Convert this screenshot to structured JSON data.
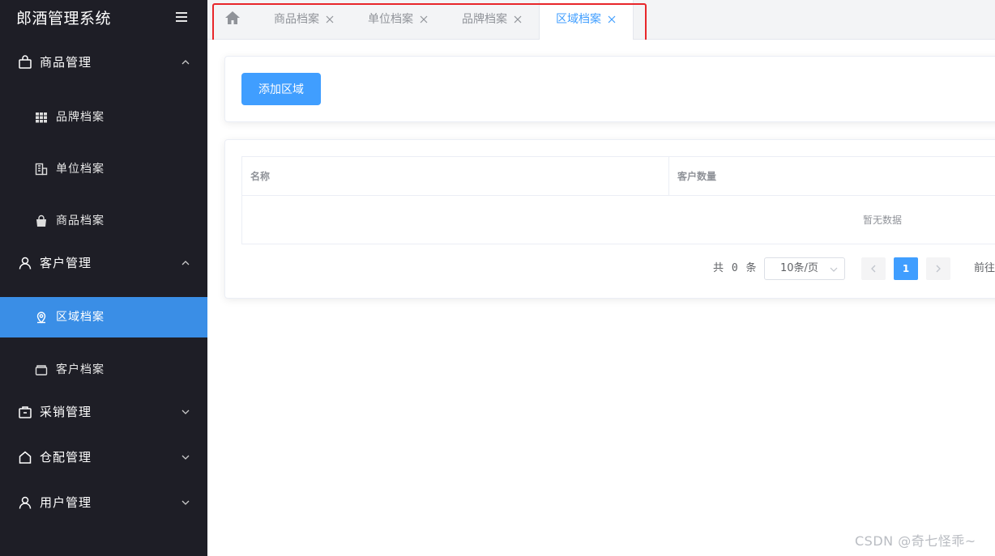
{
  "sidebar": {
    "brand": "郎酒管理系统",
    "groups": [
      {
        "label": "商品管理",
        "icon": "shopping-bag-icon"
      },
      {
        "label": "客户管理",
        "icon": "user-icon"
      },
      {
        "label": "采销管理",
        "icon": "briefcase-icon"
      },
      {
        "label": "仓配管理",
        "icon": "house-icon"
      },
      {
        "label": "用户管理",
        "icon": "user-icon"
      }
    ],
    "items": [
      {
        "label": "品牌档案",
        "icon": "grid-icon"
      },
      {
        "label": "单位档案",
        "icon": "office-building-icon"
      },
      {
        "label": "商品档案",
        "icon": "bag-icon"
      },
      {
        "label": "区域档案",
        "icon": "location-pin-icon"
      },
      {
        "label": "客户档案",
        "icon": "wallet-icon"
      }
    ],
    "active_color": "#3a8ee6",
    "background": "#1e1e26"
  },
  "tabs": [
    {
      "label": "商品档案"
    },
    {
      "label": "单位档案"
    },
    {
      "label": "品牌档案"
    },
    {
      "label": "区域档案"
    }
  ],
  "active_tab_color": "#409eff",
  "toolbar": {
    "add_label": "添加区域"
  },
  "table": {
    "columns": [
      "名称",
      "客户数量"
    ],
    "empty_text": "暂无数据"
  },
  "pagination": {
    "total_text": "共 0 条",
    "page_size": "10条/页",
    "current_page": "1",
    "goto_label": "前往"
  },
  "watermark": "CSDN @奇七怪乖~"
}
